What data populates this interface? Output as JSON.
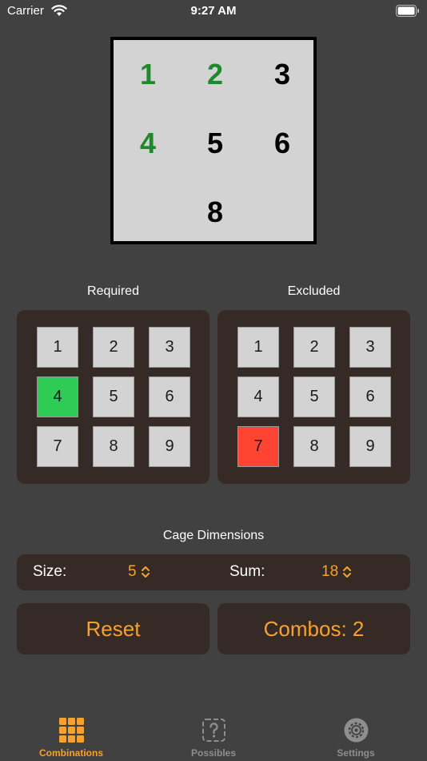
{
  "status_bar": {
    "carrier": "Carrier",
    "time": "9:27 AM"
  },
  "preview": {
    "cells": [
      {
        "value": "1",
        "color": "#1e8a2b"
      },
      {
        "value": "2",
        "color": "#1e8a2b"
      },
      {
        "value": "3",
        "color": "#000000"
      },
      {
        "value": "4",
        "color": "#1e8a2b"
      },
      {
        "value": "5",
        "color": "#000000"
      },
      {
        "value": "6",
        "color": "#000000"
      },
      {
        "value": "",
        "color": "#000000"
      },
      {
        "value": "8",
        "color": "#000000"
      },
      {
        "value": "",
        "color": "#000000"
      }
    ]
  },
  "required": {
    "title": "Required",
    "keys": [
      "1",
      "2",
      "3",
      "4",
      "5",
      "6",
      "7",
      "8",
      "9"
    ],
    "selected": [
      "4"
    ]
  },
  "excluded": {
    "title": "Excluded",
    "keys": [
      "1",
      "2",
      "3",
      "4",
      "5",
      "6",
      "7",
      "8",
      "9"
    ],
    "selected": [
      "7"
    ]
  },
  "cage": {
    "title": "Cage Dimensions",
    "size_label": "Size:",
    "size_value": "5",
    "sum_label": "Sum:",
    "sum_value": "18"
  },
  "actions": {
    "reset_label": "Reset",
    "combos_label": "Combos: 2"
  },
  "tabs": [
    {
      "label": "Combinations",
      "icon": "grid-icon",
      "active": true
    },
    {
      "label": "Possibles",
      "icon": "question-square-icon",
      "active": false
    },
    {
      "label": "Settings",
      "icon": "gear-icon",
      "active": false
    }
  ],
  "colors": {
    "accent": "#f7a12e",
    "required_on": "#2ecc55",
    "excluded_on": "#ff4433",
    "panel": "#352a26",
    "background": "#414141",
    "inactive_tab": "#8e8e8e"
  }
}
